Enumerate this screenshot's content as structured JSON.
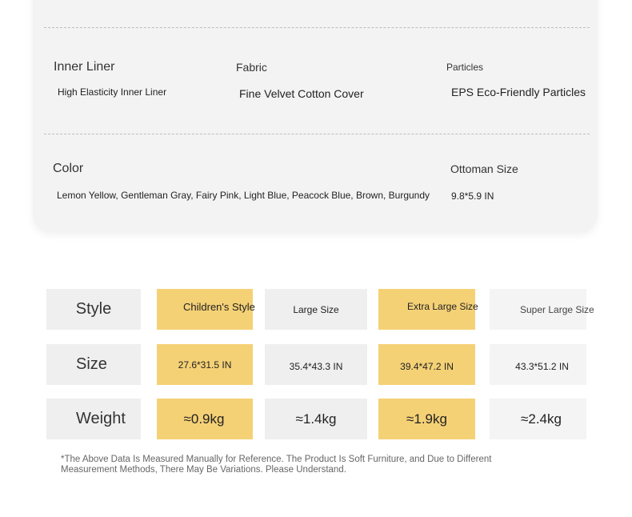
{
  "specs": {
    "row1": [
      {
        "label": "Inner Liner",
        "value": "High Elasticity Inner Liner"
      },
      {
        "label": "Fabric",
        "value": "Fine Velvet Cotton Cover"
      },
      {
        "label": "Particles",
        "value": "EPS Eco-Friendly Particles"
      }
    ],
    "row2": [
      {
        "label": "Color",
        "value": "Lemon Yellow, Gentleman Gray, Fairy Pink, Light Blue, Peacock Blue, Brown, Burgundy"
      },
      {
        "label": "Ottoman Size",
        "value": "9.8*5.9 IN"
      }
    ]
  },
  "table": {
    "headers": [
      "Style",
      "Size",
      "Weight"
    ],
    "styles": [
      "Children's Style",
      "Large Size",
      "Extra Large Size",
      "Super Large Size"
    ],
    "sizes": [
      "27.6*31.5 IN",
      "35.4*43.3 IN",
      "39.4*47.2 IN",
      "43.3*51.2 IN"
    ],
    "weights": [
      "≈0.9kg",
      "≈1.4kg",
      "≈1.9kg",
      "≈2.4kg"
    ],
    "highlight_color": "#f5d176",
    "neutral_color": "#efefef"
  },
  "note": "*The Above Data Is Measured Manually for Reference. The Product Is Soft Furniture, and Due to Different Measurement Methods, There May Be Variations. Please Understand."
}
